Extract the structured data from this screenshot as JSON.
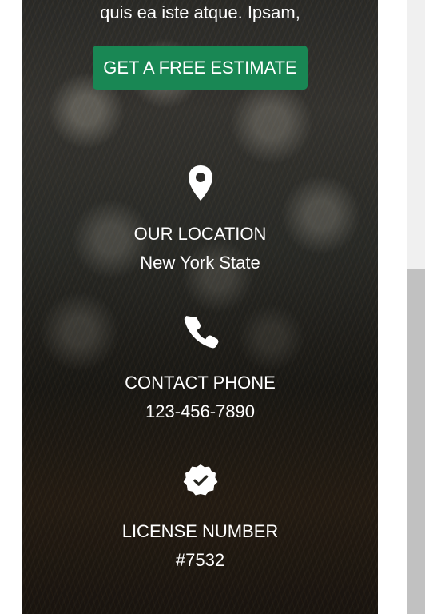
{
  "hero": {
    "text": "quis ea iste atque. Ipsam,",
    "cta_label": "GET A FREE ESTIMATE",
    "button_color": "#198754"
  },
  "info": {
    "location": {
      "icon": "map-pin-icon",
      "title": "OUR LOCATION",
      "value": "New York State"
    },
    "phone": {
      "icon": "phone-icon",
      "title": "CONTACT PHONE",
      "value": "123-456-7890"
    },
    "license": {
      "icon": "badge-check-icon",
      "title": "LICENSE NUMBER",
      "value": "#7532"
    }
  },
  "scrollbar": {
    "track_color": "#f0f0f0",
    "thumb_color": "#c1c1c1"
  }
}
